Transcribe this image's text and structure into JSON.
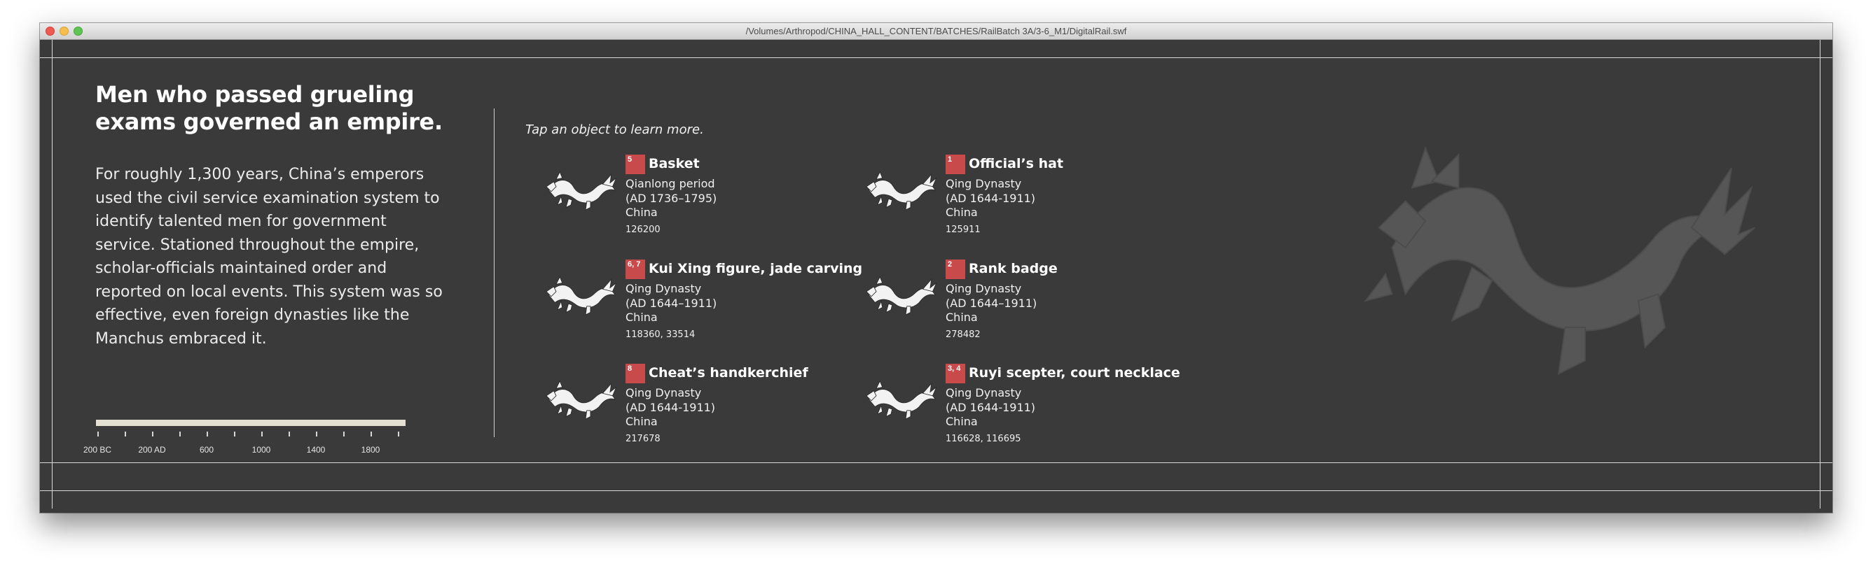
{
  "window": {
    "title": "/Volumes/Arthropod/CHINA_HALL_CONTENT/BATCHES/RailBatch 3A/3-6_M1/DigitalRail.swf"
  },
  "intro": {
    "headline": "Men who passed grueling exams governed an empire.",
    "body": "For roughly 1,300 years, China’s emperors used the civil service examination system to identify talented men for government service. Stationed throughout the empire, scholar-officials maintained order and reported on local events. This system was so effective, even foreign dynasties like the Manchus embraced it."
  },
  "timeline": {
    "labels": [
      "200 BC",
      "200 AD",
      "600",
      "1000",
      "1400",
      "1800"
    ]
  },
  "prompt": "Tap an object to learn more.",
  "items": [
    {
      "num": "5",
      "name": "Basket",
      "period": "Qianlong period",
      "dates": "(AD 1736–1795)",
      "place": "China",
      "accession": "126200"
    },
    {
      "num": "1",
      "name": "Official’s hat",
      "period": "Qing Dynasty",
      "dates": "(AD 1644-1911)",
      "place": "China",
      "accession": "125911"
    },
    {
      "num": "6, 7",
      "name": "Kui Xing figure, jade carving",
      "period": "Qing Dynasty",
      "dates": "(AD 1644–1911)",
      "place": "China",
      "accession": "118360, 33514"
    },
    {
      "num": "2",
      "name": "Rank badge",
      "period": "Qing Dynasty",
      "dates": "(AD 1644–1911)",
      "place": "China",
      "accession": "278482"
    },
    {
      "num": "8",
      "name": "Cheat’s handkerchief",
      "period": "Qing Dynasty",
      "dates": "(AD 1644-1911)",
      "place": "China",
      "accession": "217678"
    },
    {
      "num": "3, 4",
      "name": "Ruyi scepter, court necklace",
      "period": "Qing Dynasty",
      "dates": "(AD 1644-1911)",
      "place": "China",
      "accession": "116628, 116695"
    }
  ],
  "colors": {
    "background": "#3a3a3a",
    "badge": "#c94a4a",
    "timeline_bar": "#e4e1d2",
    "dragon_watermark": "#5a5a5a"
  },
  "icons": {
    "item_thumbnail": "dragon-icon",
    "watermark": "dragon-watermark-icon"
  }
}
